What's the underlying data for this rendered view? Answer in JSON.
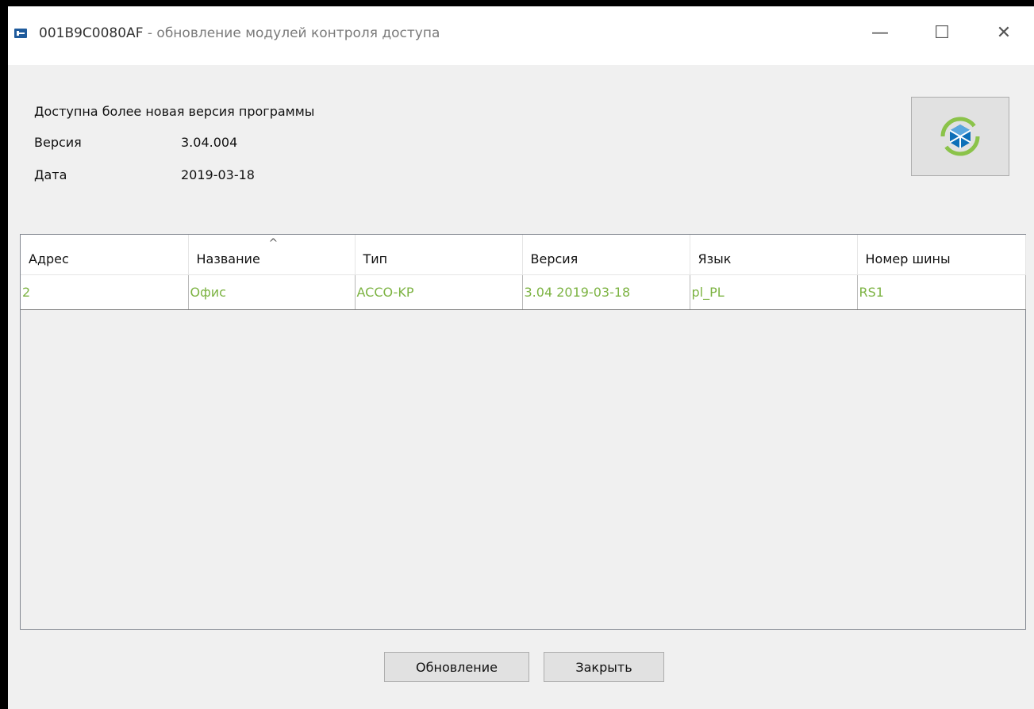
{
  "window": {
    "device_id": "001B9C0080AF",
    "separator": " - ",
    "title": "обновление модулей контроля доступа",
    "controls": {
      "minimize": "—",
      "maximize": "☐",
      "close": "✕"
    }
  },
  "info": {
    "banner": "Доступна более новая версия программы",
    "version_label": "Версия",
    "version_value": "3.04.004",
    "date_label": "Дата",
    "date_value": "2019-03-18"
  },
  "refresh_icon": "refresh-cube-icon",
  "table": {
    "columns": [
      "Адрес",
      "Название",
      "Тип",
      "Версия",
      "Язык",
      "Номер шины"
    ],
    "sort_indicator": "^",
    "rows": [
      [
        "2",
        "Офис",
        "ACCO-KP",
        "3.04 2019-03-18",
        "pl_PL",
        "RS1"
      ]
    ]
  },
  "buttons": {
    "update": "Обновление",
    "close": "Закрыть"
  },
  "colors": {
    "row_text": "#7cb342",
    "title_icon": "#1f5b9c"
  }
}
